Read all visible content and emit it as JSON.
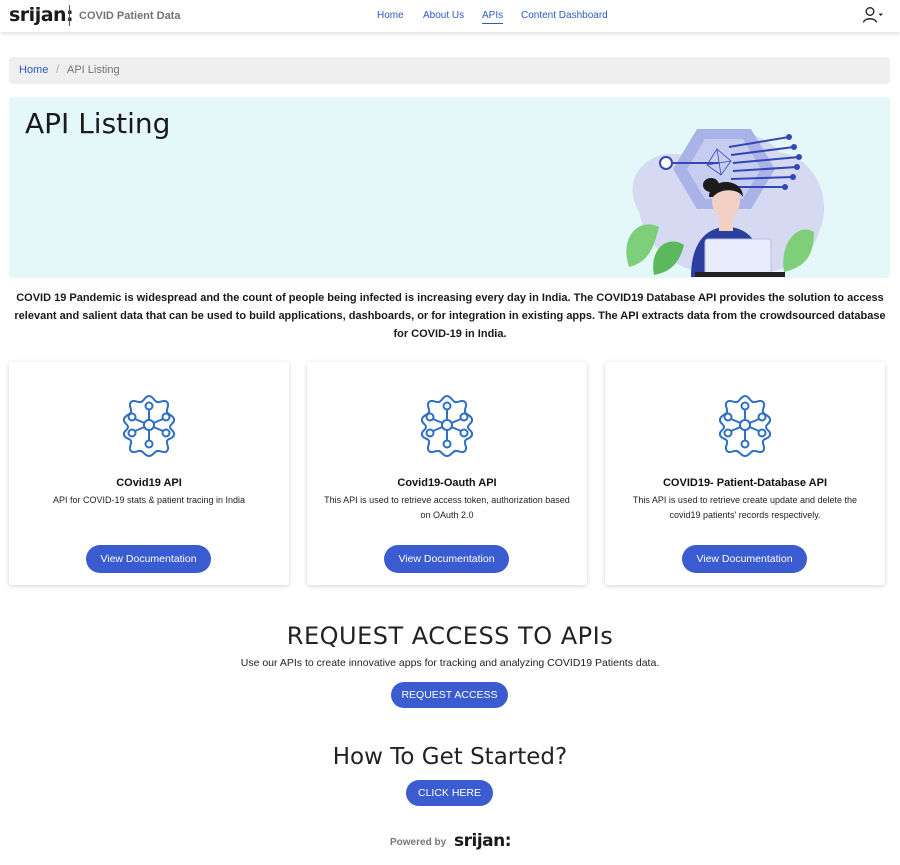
{
  "header": {
    "logo": "srijan:",
    "site_name": "COVID Patient Data",
    "nav": [
      {
        "label": "Home"
      },
      {
        "label": "About Us"
      },
      {
        "label": "APIs"
      },
      {
        "label": "Content Dashboard"
      }
    ],
    "user_icon": "user-icon"
  },
  "breadcrumb": {
    "home": "Home",
    "separator": "/",
    "current": "API Listing"
  },
  "hero": {
    "title": "API Listing"
  },
  "intro": "COVID 19 Pandemic is widespread and the count of people being infected is increasing every day in India. The COVID19 Database API provides the solution to access relevant and salient data that can be used to build applications, dashboards, or for integration in existing apps. The API extracts data from the crowdsourced database for COVID-19 in India.",
  "cards": [
    {
      "title": "COvid19 API",
      "description": "API for COVID-19 stats & patient tracing in India",
      "button": "View Documentation"
    },
    {
      "title": "Covid19-Oauth API",
      "description": "This API is used to retrieve access token, authorization based on OAuth 2.0",
      "button": "View Documentation"
    },
    {
      "title": "COVID19- Patient-Database API",
      "description": "This API is used to retrieve create update and delete the covid19 patients' records respectively.",
      "button": "View Documentation"
    }
  ],
  "request": {
    "title": "REQUEST ACCESS TO APIs",
    "subtitle": "Use our APIs to create innovative apps for tracking and analyzing COVID19 Patients data.",
    "button": "REQUEST ACCESS"
  },
  "started": {
    "title": "How To Get Started?",
    "button": "CLICK HERE"
  },
  "footer": {
    "powered_by": "Powered by",
    "logo": "srijan:"
  },
  "colors": {
    "accent": "#3b5cd0",
    "link": "#2c5bbf",
    "hero_bg": "#e4f8f9",
    "breadcrumb_bg": "#efefef"
  }
}
